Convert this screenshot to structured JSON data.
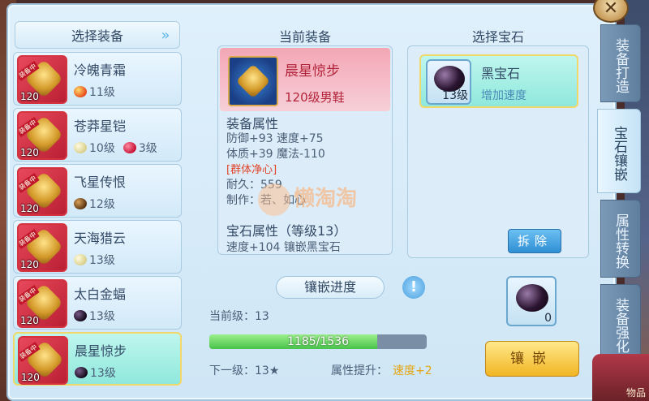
{
  "left_list": {
    "header": "选择装备",
    "items": [
      {
        "name": "冷魄青霜",
        "level": "120",
        "tag": "装备中",
        "gems": [
          {
            "type": "red",
            "label": "11级"
          }
        ]
      },
      {
        "name": "苍莽星铠",
        "level": "120",
        "tag": "装备中",
        "gems": [
          {
            "type": "pearl",
            "label": "10级"
          },
          {
            "type": "ruby",
            "label": "3级"
          }
        ]
      },
      {
        "name": "飞星传恨",
        "level": "120",
        "tag": "装备中",
        "gems": [
          {
            "type": "brown",
            "label": "12级"
          }
        ]
      },
      {
        "name": "天海猎云",
        "level": "120",
        "tag": "装备中",
        "gems": [
          {
            "type": "pearl",
            "label": "13级"
          }
        ]
      },
      {
        "name": "太白金蝠",
        "level": "120",
        "tag": "装备中",
        "gems": [
          {
            "type": "black",
            "label": "13级"
          }
        ]
      },
      {
        "name": "晨星惊步",
        "level": "120",
        "tag": "装备中",
        "gems": [
          {
            "type": "black",
            "label": "13级"
          }
        ]
      }
    ]
  },
  "current_equip": {
    "title": "当前装备",
    "name": "晨星惊步",
    "subtitle": "120级男鞋",
    "attr_header": "装备属性",
    "attr_line1": "防御+93 速度+75",
    "attr_line2": "体质+39 魔法-110",
    "special": "[群体净心]",
    "durability": "耐久：559",
    "maker": "制作：若、如心",
    "gem_attr_header": "宝石属性（等级13）",
    "gem_attr_line": "速度+104 镶嵌黑宝石"
  },
  "watermark": "懒淘淘",
  "progress": {
    "label": "镶嵌进度",
    "current_level": "当前级：13",
    "value_text": "1185/1536",
    "fraction": 0.7715,
    "next_level": "下一级：13★",
    "attr_up_label": "属性提升：",
    "attr_up_value": "速度+2"
  },
  "gem_select": {
    "title": "选择宝石",
    "gem_name": "黑宝石",
    "gem_level": "13级",
    "gem_desc": "增加速度",
    "remove_label": "拆除",
    "owned_count": "0",
    "inlay_label": "镶嵌"
  },
  "tabs": [
    "装备打造",
    "宝石镶嵌",
    "属性转换",
    "装备强化"
  ],
  "corner_text": "物品"
}
